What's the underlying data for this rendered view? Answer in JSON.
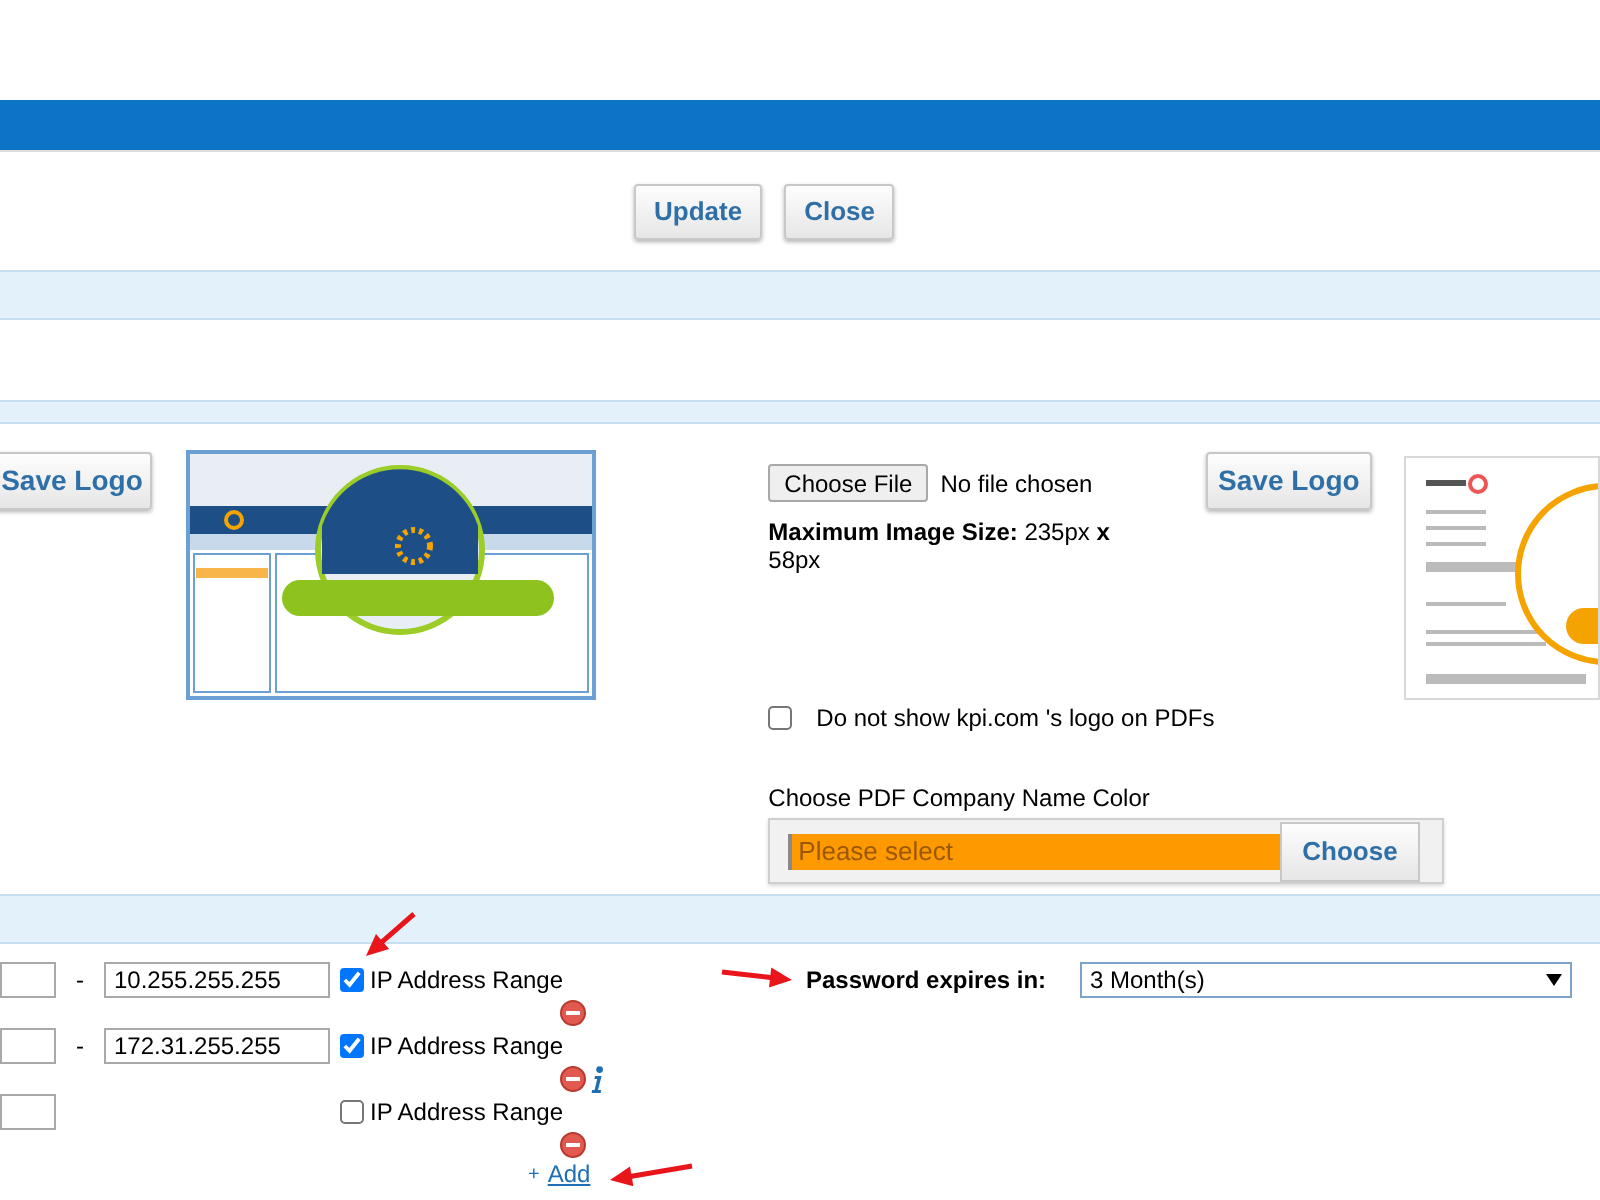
{
  "header_buttons": [
    {
      "label": "Update"
    },
    {
      "label": "Close"
    }
  ],
  "web_logo": {
    "save_button": "Save Logo"
  },
  "pdf_logo": {
    "file_button": "Choose File",
    "file_status": "No file chosen",
    "size_note": "**Maximum Image Size:** 235px **x** 58px",
    "save_button": "Save Logo",
    "hide_logo_option": {
      "label": "Do not show kpi.com 's logo on PDFs",
      "checked": false
    },
    "color_picker": {
      "label": "Choose PDF Company Name Color",
      "placeholder": "Please select",
      "button": "Choose"
    }
  },
  "ip_ranges": [
    {
      "separator": "-",
      "to": "10.255.255.255",
      "range": true,
      "label": "IP Address Range",
      "info": false
    },
    {
      "separator": "-",
      "to": "172.31.255.255",
      "range": true,
      "label": "IP Address Range",
      "info": true
    },
    {
      "range": false,
      "label": "IP Address Range",
      "info": false
    }
  ],
  "add_link": {
    "symbol": "+",
    "label": "Add"
  },
  "password_expiry": {
    "label": "Password expires in:",
    "value": "3 Month(s)"
  }
}
